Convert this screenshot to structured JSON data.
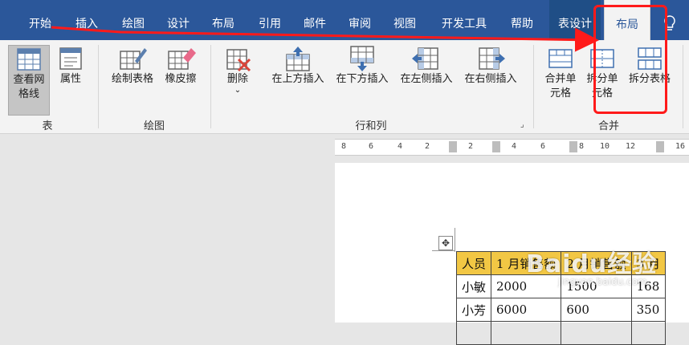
{
  "tabs": [
    {
      "label": "开始"
    },
    {
      "label": "插入"
    },
    {
      "label": "绘图"
    },
    {
      "label": "设计"
    },
    {
      "label": "布局"
    },
    {
      "label": "引用"
    },
    {
      "label": "邮件"
    },
    {
      "label": "审阅"
    },
    {
      "label": "视图"
    },
    {
      "label": "开发工具"
    },
    {
      "label": "帮助"
    },
    {
      "label": "表设计"
    },
    {
      "label": "布局"
    }
  ],
  "ribbon": {
    "table_group": {
      "label": "表",
      "view_gridlines": "查看网格线",
      "properties": "属性"
    },
    "draw_group": {
      "label": "绘图",
      "draw_table": "绘制表格",
      "eraser": "橡皮擦"
    },
    "rows_cols_group": {
      "label": "行和列",
      "delete": "删除",
      "insert_above": "在上方插入",
      "insert_below": "在下方插入",
      "insert_left": "在左侧插入",
      "insert_right": "在右侧插入"
    },
    "merge_group": {
      "label": "合并",
      "merge_cells": "合并单元格",
      "split_cells": "拆分单元格",
      "split_table": "拆分表格"
    }
  },
  "ruler": {
    "ticks": [
      "8",
      "6",
      "4",
      "2",
      "2",
      "4",
      "6",
      "8",
      "10",
      "12",
      "16"
    ]
  },
  "table": {
    "header": [
      "人员",
      "1 月销售额",
      "2 月销售额",
      "3 月"
    ],
    "rows": [
      [
        "小敏",
        "2000",
        "1500",
        "168"
      ],
      [
        "小芳",
        "6000",
        "600",
        "350"
      ]
    ]
  },
  "watermark": {
    "text": "Baidu经验",
    "sub": "jingyan.baidu.com"
  },
  "colors": {
    "tab_bar": "#2b579a",
    "ribbon": "#f3f3f3",
    "highlight": "#ff1a1a",
    "table_header": "#f2c744"
  }
}
